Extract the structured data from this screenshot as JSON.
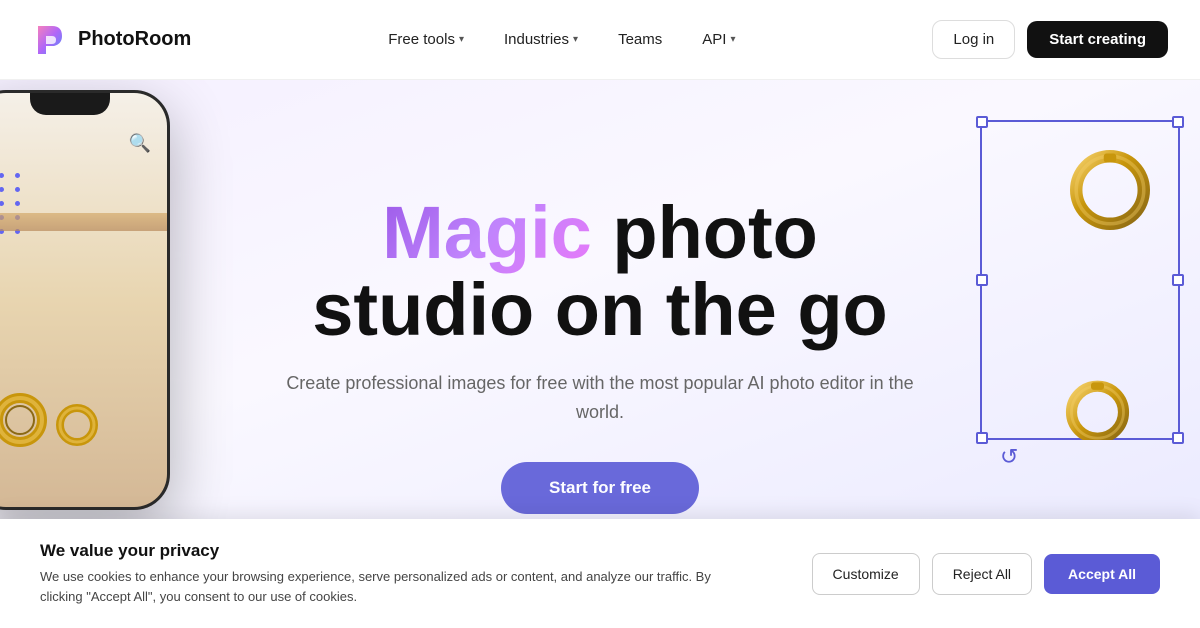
{
  "nav": {
    "logo_text": "PhotoRoom",
    "links": [
      {
        "label": "Free tools",
        "has_dropdown": true
      },
      {
        "label": "Industries",
        "has_dropdown": true
      },
      {
        "label": "Teams",
        "has_dropdown": false
      },
      {
        "label": "API",
        "has_dropdown": true
      }
    ],
    "login_label": "Log in",
    "start_label": "Start creating"
  },
  "hero": {
    "title_magic": "Magic",
    "title_rest": " photo studio on the go",
    "subtitle": "Create professional images for free with the most popular AI photo editor in the world.",
    "cta_label": "Start for free"
  },
  "cookie": {
    "title": "We value your privacy",
    "description": "We use cookies to enhance your browsing experience, serve personalized ads or content, and analyze our traffic. By clicking \"Accept All\", you consent to our use of cookies.",
    "customize_label": "Customize",
    "reject_label": "Reject All",
    "accept_label": "Accept All"
  }
}
